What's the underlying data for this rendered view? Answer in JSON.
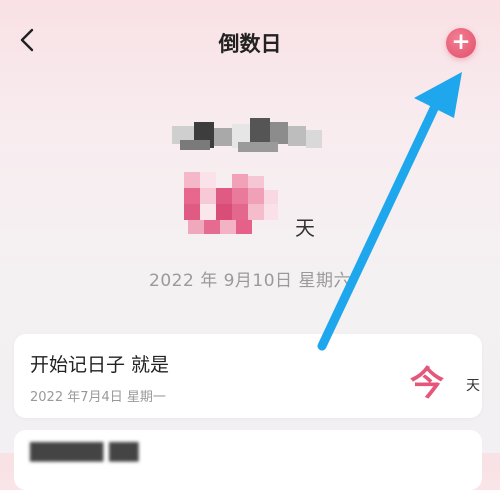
{
  "nav": {
    "title": "倒数日",
    "back_icon": "chevron-left-icon",
    "add_icon": "plus-icon",
    "add_symbol": "+",
    "accent_color": "#e2506a"
  },
  "hero": {
    "unit": "天",
    "date": "2022 年 9月10日 星期六",
    "count_color": "#e5577a"
  },
  "events": [
    {
      "title": "开始记日子 就是",
      "date": "2022 年7月4日  星期一",
      "value": "今",
      "unit": "天"
    }
  ],
  "annotation": {
    "arrow_color": "#1ea7ec"
  }
}
